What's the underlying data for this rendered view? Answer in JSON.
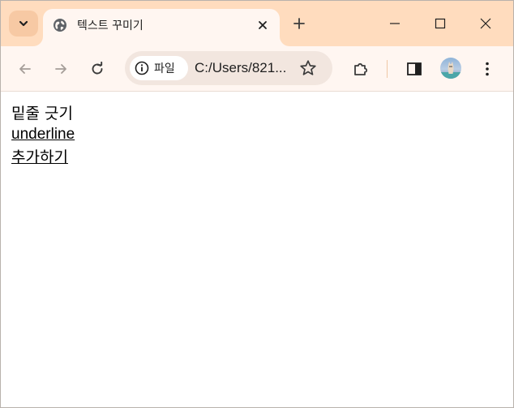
{
  "browser": {
    "tab": {
      "title": "텍스트 꾸미기",
      "favicon": "globe-icon"
    },
    "tabstrip": {
      "search_icon": "chevron-down-icon",
      "new_tab_icon": "plus-icon"
    },
    "window_controls": [
      "minimize-icon",
      "maximize-icon",
      "close-icon"
    ],
    "toolbar": {
      "back_icon": "arrow-left-icon",
      "forward_icon": "arrow-right-icon",
      "reload_icon": "reload-icon",
      "site_info_chip_label": "파일",
      "site_info_icon": "info-icon",
      "url": "C:/Users/821...",
      "bookmark_icon": "star-icon",
      "extensions_icon": "puzzle-icon",
      "side_panel_icon": "side-panel-icon",
      "profile_icon": "avatar",
      "menu_icon": "kebab-icon"
    },
    "colors": {
      "tabstrip_bg": "#ffdcbe",
      "active_tab_bg": "#fff6f1",
      "omnibox_bg": "#f2e6df"
    }
  },
  "page": {
    "lines": [
      {
        "text": "밑줄 긋기",
        "underline": false
      },
      {
        "text": "underline",
        "underline": true
      },
      {
        "text": "추가하기",
        "underline": true
      }
    ]
  }
}
